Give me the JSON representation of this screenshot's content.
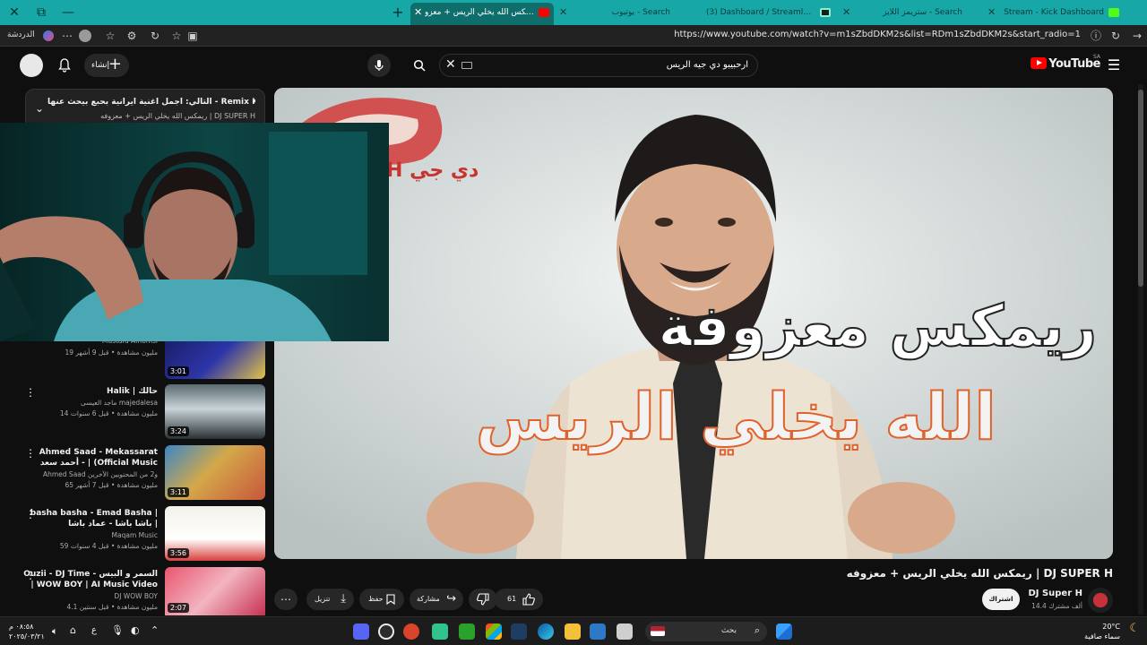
{
  "browser": {
    "tabs": [
      {
        "label": "Stream - Kick Dashboard",
        "active": false
      },
      {
        "label": "ستريمز اللايز - Search",
        "active": false
      },
      {
        "label": "(3) Dashboard / Streamlabs",
        "active": false
      },
      {
        "label": "يوتيوب - Search",
        "active": false
      },
      {
        "label": "ريمكس الله يخلي الريس + معزو...",
        "active": true
      }
    ],
    "url": "https://www.youtube.com/watch?v=m1sZbdDKM2s&list=RDm1sZbdDKM2s&start_radio=1",
    "guest_label": "الدردشة"
  },
  "header": {
    "search_value": "ارحبيبو دي جيه الريس",
    "create_label": "إنشاء",
    "logo_text": "YouTube",
    "country_code": "SA"
  },
  "playlist": {
    "title": "التالي: أجمل أغنية ايرانية بحبع بيحث عنها - Remix Kambalad n...",
    "subtitle": "ريمكس الله يخلي الريس + معزوفه | DJ SUPER H"
  },
  "recommendations": [
    {
      "title": "",
      "channel": "Mustafa Alhomsi",
      "meta": "19 مليون مشاهدة • قبل 9 أشهر",
      "duration": "3:01"
    },
    {
      "title": "Halik | حالك",
      "channel": "ماجد العيسى majedalesa",
      "meta": "14 مليون مشاهدة • قبل 6 سنوات",
      "duration": "3:24"
    },
    {
      "title": "Ahmed Saad - Mekassarat أحمد سعد - | (Official Music Video)...",
      "channel": "Ahmed Saad و2 من المحتويين الآخرين",
      "meta": "65 مليون مشاهدة • قبل 7 أشهر",
      "duration": "3:11"
    },
    {
      "title": "basha basha - Emad Basha | باشا باشا - عماد باشا | exclusive | 2021",
      "channel": "Maqam Music",
      "meta": "59 مليون مشاهدة • قبل 4 سنوات",
      "duration": "3:56"
    },
    {
      "title": "Ouzii - DJ Time - السمر و البيس | WOW BOY | AI Music Video",
      "channel": "DJ WOW BOY",
      "meta": "4.1 مليون مشاهدة • قبل سنتين",
      "duration": "2:07"
    }
  ],
  "video": {
    "title": "ريمكس الله يخلي الريس + معزوفه | DJ SUPER H",
    "overlay_line1": "ريمكس معزوفة",
    "overlay_line2": "الله يخلي الريس",
    "logo_text": "H دي جي",
    "channel": "DJ Super H",
    "subscribers": "14.4 ألف مشترك",
    "subscribe_label": "اشتراك",
    "likes": "61",
    "share_label": "مشاركة",
    "save_label": "حفظ",
    "download_label": "تنزيل"
  },
  "taskbar": {
    "search_label": "بحث",
    "clock_time": "٠٨:٥٨ م",
    "clock_date": "٢٠٢٥/٠٣/٢١",
    "weather_temp": "20°C",
    "weather_desc": "سماء صافية",
    "lang": "ع"
  },
  "colors": {
    "teal_tab": "#17a7a6",
    "yt_red": "#ff0000",
    "overlay_orange": "#e0622c"
  }
}
